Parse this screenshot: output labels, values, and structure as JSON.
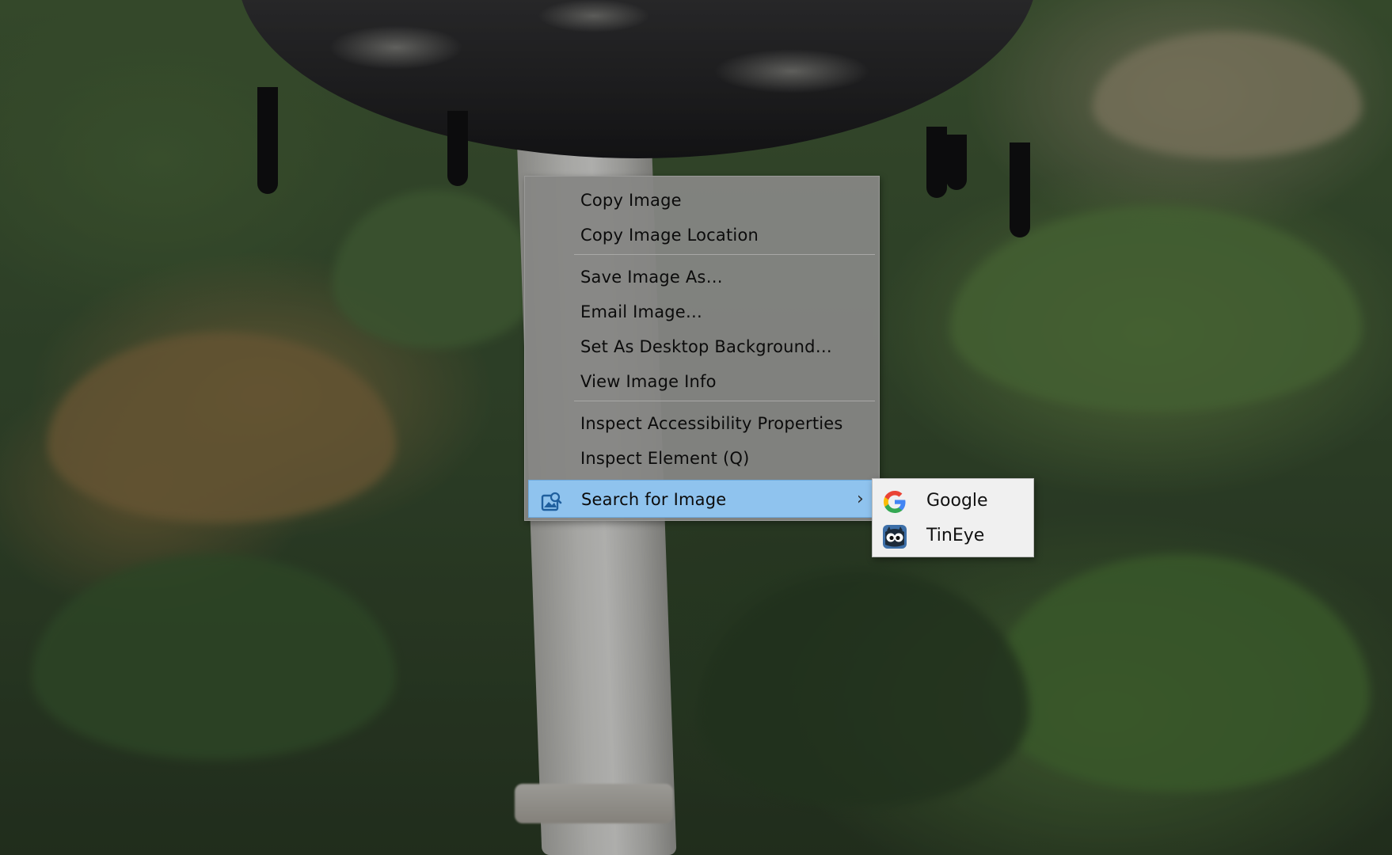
{
  "context_menu": {
    "items": [
      {
        "label": "Copy Image"
      },
      {
        "label": "Copy Image Location"
      },
      {
        "label": "Save Image As…"
      },
      {
        "label": "Email Image…"
      },
      {
        "label": "Set As Desktop Background…"
      },
      {
        "label": "View Image Info"
      },
      {
        "label": "Inspect Accessibility Properties"
      },
      {
        "label": "Inspect Element (Q)"
      },
      {
        "label": "Search for Image",
        "icon": "search-image-icon",
        "active": true,
        "has_submenu": true
      }
    ],
    "submenu_arrow": "›"
  },
  "search_submenu": {
    "items": [
      {
        "label": "Google",
        "icon": "google-icon"
      },
      {
        "label": "TinEye",
        "icon": "tineye-icon"
      }
    ]
  },
  "colors": {
    "menu_background": "#868684",
    "active_item": "#8fc3ee",
    "submenu_background": "#f0f0f0"
  }
}
